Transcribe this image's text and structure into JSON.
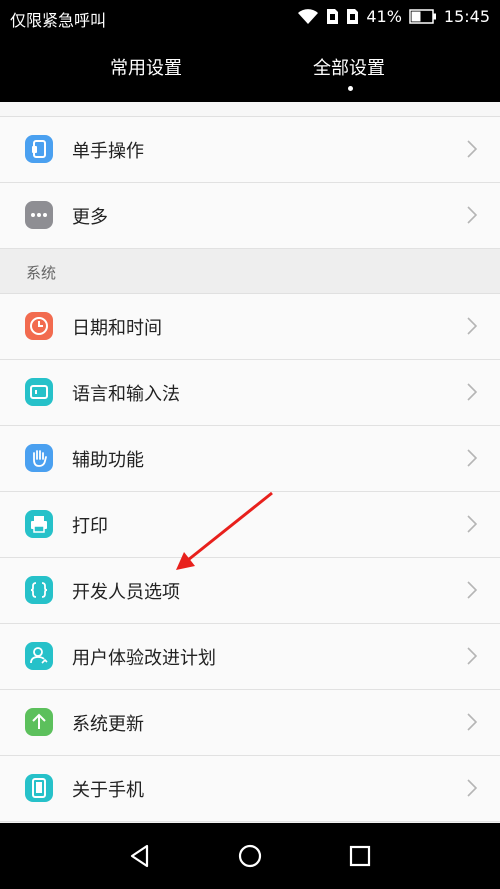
{
  "status": {
    "carrier": "仅限紧急呼叫",
    "battery": "41%",
    "time": "15:45"
  },
  "tabs": {
    "common": "常用设置",
    "all": "全部设置"
  },
  "rows_top": [
    {
      "label": "单手操作",
      "icon": "one-hand-icon",
      "color": "#4aa0f0"
    },
    {
      "label": "更多",
      "icon": "more-dots-icon",
      "color": "#8e8e93"
    }
  ],
  "section": {
    "label": "系统"
  },
  "rows_system": [
    {
      "label": "日期和时间",
      "icon": "clock-icon",
      "color": "#f26b4f"
    },
    {
      "label": "语言和输入法",
      "icon": "keyboard-icon",
      "color": "#26c1c9"
    },
    {
      "label": "辅助功能",
      "icon": "hand-icon",
      "color": "#4aa0f0"
    },
    {
      "label": "打印",
      "icon": "printer-icon",
      "color": "#26c1c9"
    },
    {
      "label": "开发人员选项",
      "icon": "braces-icon",
      "color": "#26c1c9"
    },
    {
      "label": "用户体验改进计划",
      "icon": "user-icon",
      "color": "#26c1c9"
    },
    {
      "label": "系统更新",
      "icon": "update-arrow-icon",
      "color": "#5cc05c"
    },
    {
      "label": "关于手机",
      "icon": "phone-icon",
      "color": "#26c1c9"
    }
  ],
  "colors": {
    "annotation_arrow": "#e8201c"
  }
}
